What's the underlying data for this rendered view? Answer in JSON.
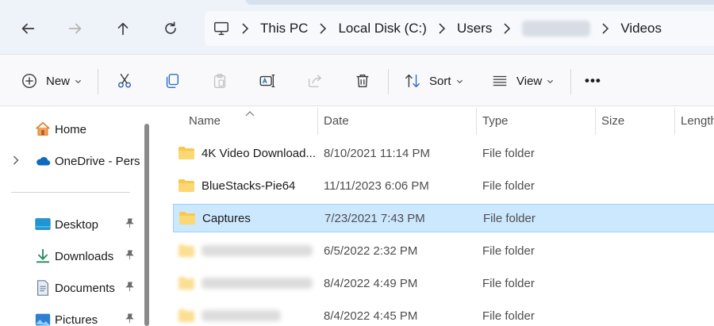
{
  "nav": {
    "back_icon": "arrow-left-icon",
    "forward_icon": "arrow-right-icon",
    "up_icon": "arrow-up-icon",
    "refresh_icon": "refresh-icon"
  },
  "address": {
    "root_icon": "computer-icon",
    "crumbs": [
      "This PC",
      "Local Disk (C:)",
      "Users",
      "",
      "Videos"
    ]
  },
  "toolbar": {
    "new_label": "New",
    "sort_label": "Sort",
    "view_label": "View",
    "more_label": "•••"
  },
  "sidebar": {
    "items": [
      {
        "label": "Home",
        "icon": "home-icon"
      },
      {
        "label": "OneDrive - Perso",
        "icon": "onedrive-cloud-icon"
      },
      {
        "label": "Desktop",
        "icon": "desktop-icon"
      },
      {
        "label": "Downloads",
        "icon": "download-icon"
      },
      {
        "label": "Documents",
        "icon": "document-icon"
      },
      {
        "label": "Pictures",
        "icon": "pictures-icon"
      }
    ]
  },
  "columns": [
    "Name",
    "Date",
    "Type",
    "Size",
    "Length"
  ],
  "files": [
    {
      "name": "4K Video Download...",
      "date": "8/10/2021 11:14 PM",
      "type": "File folder"
    },
    {
      "name": "BlueStacks-Pie64",
      "date": "11/11/2023 6:06 PM",
      "type": "File folder"
    },
    {
      "name": "Captures",
      "date": "7/23/2021 7:43 PM",
      "type": "File folder"
    },
    {
      "name": "",
      "date": "6/5/2022 2:32 PM",
      "type": "File folder"
    },
    {
      "name": "",
      "date": "8/4/2022 4:49 PM",
      "type": "File folder"
    },
    {
      "name": "",
      "date": "8/4/2022 4:45 PM",
      "type": "File folder"
    }
  ],
  "colors": {
    "selection": "#cce8ff",
    "selection_border": "#99d1ff",
    "folder": "#f8c94a",
    "accent": "#0067c0"
  }
}
